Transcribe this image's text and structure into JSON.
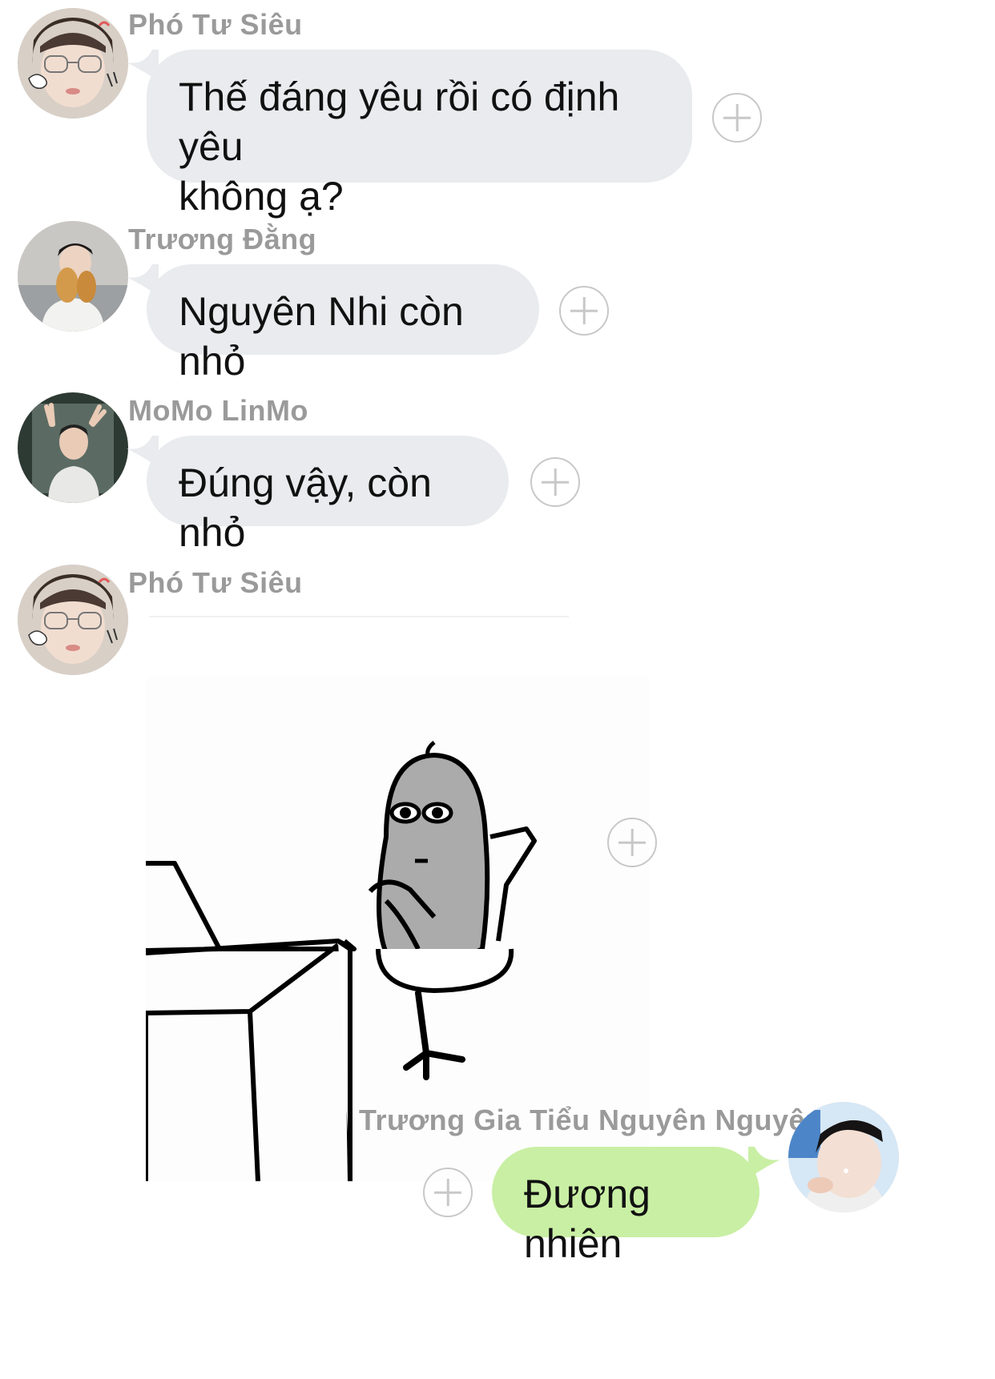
{
  "messages": [
    {
      "sender": "Phó Tư Siêu",
      "text": "Thế đáng yêu rồi có định yêu\nkhông ạ?",
      "avatar_icon": "avatar-glasses-boy-icon"
    },
    {
      "sender": "Trương Đằng",
      "text": "Nguyên Nhi còn nhỏ",
      "avatar_icon": "avatar-boy-holding-bread-icon"
    },
    {
      "sender": "MoMo LinMo",
      "text": "Đúng vậy, còn nhỏ",
      "avatar_icon": "avatar-boy-waving-icon"
    },
    {
      "sender": "Phó Tư Siêu",
      "sticker": "sticker-blob-sitting-at-desk",
      "avatar_icon": "avatar-glasses-boy-icon"
    },
    {
      "sender": "Trương Gia Tiểu Nguyên Nguyên",
      "text": "Đương nhiên",
      "avatar_icon": "avatar-boy-selfie-icon",
      "outgoing": true
    }
  ],
  "colors": {
    "incoming_bubble": "#e9ebee",
    "outgoing_bubble": "#c9efa4",
    "sender_name": "#9a9a9a",
    "plus_icon": "#c8c8c8"
  },
  "icons": {
    "reaction": "plus-circle-icon"
  }
}
